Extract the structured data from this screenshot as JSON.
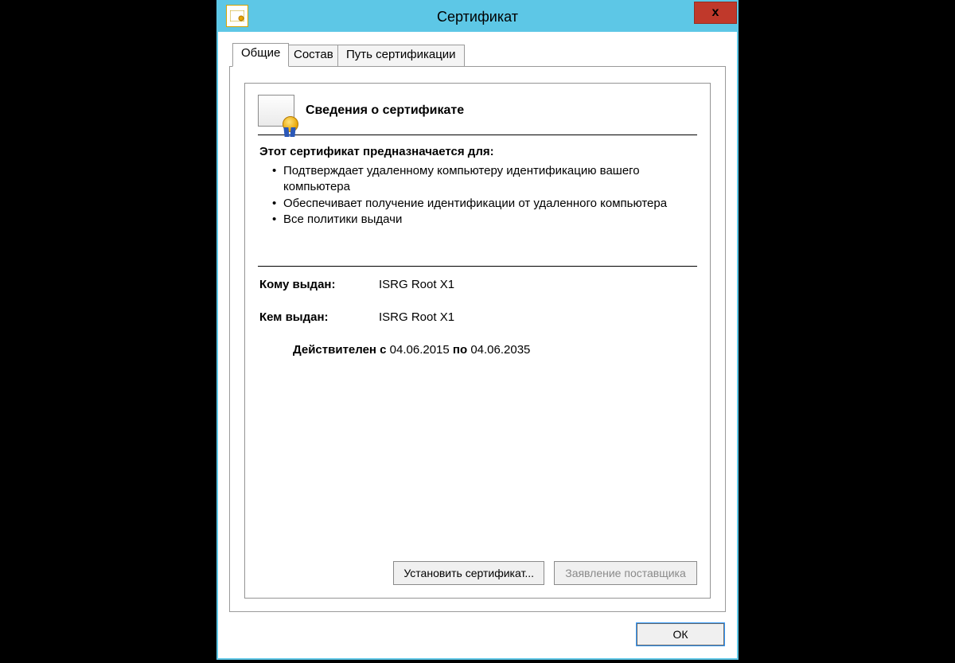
{
  "window": {
    "title": "Сертификат",
    "close_glyph": "x"
  },
  "tabs": {
    "general": "Общие",
    "details": "Состав",
    "path": "Путь сертификации"
  },
  "info": {
    "heading": "Сведения о сертификате",
    "purpose_heading": "Этот сертификат предназначается для:",
    "purposes": [
      "Подтверждает удаленному компьютеру идентификацию вашего компьютера",
      "Обеспечивает получение идентификации от удаленного компьютера",
      "Все политики выдачи"
    ],
    "issued_to_label": "Кому выдан:",
    "issued_to_value": "ISRG Root X1",
    "issued_by_label": "Кем выдан:",
    "issued_by_value": "ISRG Root X1",
    "valid_from_label": "Действителен с",
    "valid_from_value": "04.06.2015",
    "valid_to_label": "по",
    "valid_to_value": "04.06.2035"
  },
  "buttons": {
    "install": "Установить сертификат...",
    "issuer_statement": "Заявление поставщика",
    "ok": "ОК"
  }
}
